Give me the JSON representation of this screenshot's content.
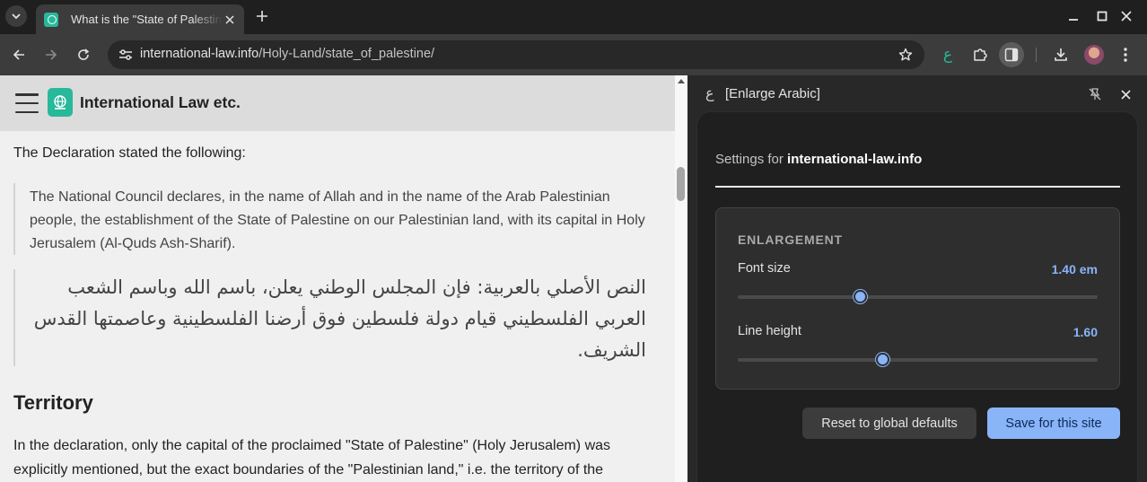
{
  "browser": {
    "tab": {
      "title": "What is the \"State of Palestine\""
    },
    "url": {
      "host": "international-law.info",
      "path": "/Holy-Land/state_of_palestine/"
    }
  },
  "site": {
    "name": "International Law etc.",
    "intro": "The Declaration stated the following:",
    "quote_en": "The National Council declares, in the name of Allah and in the name of the Arab Palestinian people, the establishment of the State of Palestine on our Palestinian land, with its capital in Holy Jerusalem (Al-Quds Ash-Sharif).",
    "quote_ar": "النص الأصلي بالعربية: فإن المجلس الوطني يعلن، باسم الله وباسم الشعب العربي الفلسطيني قيام دولة فلسطين فوق أرضنا الفلسطينية وعاصمتها القدس الشريف.",
    "heading_territory": "Territory",
    "body": "In the declaration, only the capital of the proclaimed \"State of Palestine\" (Holy Jerusalem) was explicitly mentioned, but the exact boundaries of the \"Palestinian land,\" i.e. the territory of the"
  },
  "panel": {
    "icon_glyph": "ع",
    "title": "[Enlarge Arabic]",
    "settings_prefix": "Settings for ",
    "settings_site": "international-law.info",
    "section_title": "ENLARGEMENT",
    "font_size": {
      "label": "Font size",
      "value_text": "1.40 em",
      "fraction": 0.34
    },
    "line_height": {
      "label": "Line height",
      "value_text": "1.60",
      "fraction": 0.403
    },
    "reset_label": "Reset to global defaults",
    "save_label": "Save for this site"
  },
  "colors": {
    "accent": "#8ab4f8",
    "brand": "#28b89a"
  }
}
